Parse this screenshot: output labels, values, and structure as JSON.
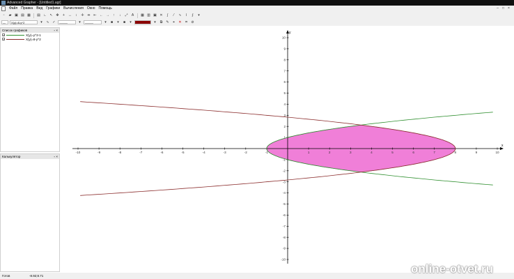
{
  "window": {
    "title": "Advanced Grapher - [Untitled1.agr]",
    "min": "–",
    "max": "□",
    "close": "×"
  },
  "menu": [
    "Файл",
    "Правка",
    "Вид",
    "Графики",
    "Вычисления",
    "Окно",
    "Помощь"
  ],
  "formula_box": {
    "value": "X(y)=8-y^2"
  },
  "graph_list": {
    "title": "Список графиков",
    "items": [
      {
        "label": "X(y)=y^2-1",
        "color": "#2f8f2f",
        "checked": true
      },
      {
        "label": "X(y)=8-y^2",
        "color": "#8b2d2d",
        "checked": true
      }
    ]
  },
  "calculator": {
    "title": "Калькулятор"
  },
  "status": {
    "left": "Готов",
    "coords": "-8.92;8.71"
  },
  "watermark": "online-otvet.ru",
  "colors": {
    "fill": "#f07fd8",
    "curve1": "#2f8f2f",
    "curve2": "#8b2d2d",
    "colorbox": "#8b0000"
  },
  "chart_data": {
    "type": "line",
    "xlim": [
      -10,
      10
    ],
    "ylim": [
      -10,
      10
    ],
    "x_ticks": [
      -10,
      -9,
      -8,
      -7,
      -6,
      -5,
      -4,
      -3,
      -2,
      -1,
      1,
      2,
      3,
      4,
      5,
      6,
      7,
      8,
      9,
      10
    ],
    "y_ticks": [
      -10,
      -9,
      -8,
      -7,
      -6,
      -5,
      -4,
      -3,
      -2,
      -1,
      1,
      2,
      3,
      4,
      5,
      6,
      7,
      8,
      9,
      10
    ],
    "xlabel": "x",
    "ylabel": "y",
    "series": [
      {
        "name": "X(y)=y^2-1",
        "color": "#2f8f2f"
      },
      {
        "name": "X(y)=8-y^2",
        "color": "#8b2d2d"
      }
    ],
    "fill_between": {
      "y_from": -2.1,
      "y_to": 2.1,
      "color": "#f07fd8"
    }
  }
}
